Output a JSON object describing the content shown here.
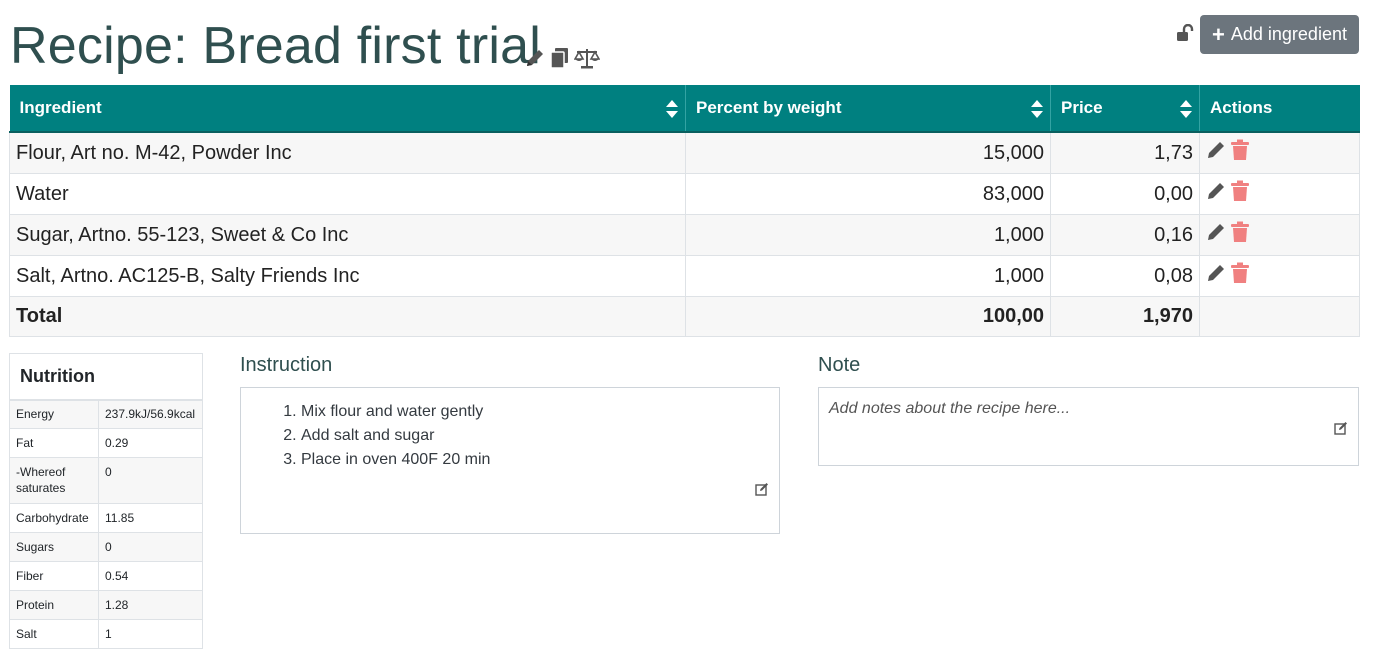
{
  "header": {
    "title": "Recipe: Bread first trial",
    "add_button_label": "Add ingredient"
  },
  "ingredients_table": {
    "columns": [
      "Ingredient",
      "Percent by weight",
      "Price",
      "Actions"
    ],
    "rows": [
      {
        "ingredient": "Flour, Art no. M-42, Powder Inc",
        "percent": "15,000",
        "price": "1,73"
      },
      {
        "ingredient": "Water",
        "percent": "83,000",
        "price": "0,00"
      },
      {
        "ingredient": "Sugar, Artno. 55-123, Sweet & Co Inc",
        "percent": "1,000",
        "price": "0,16"
      },
      {
        "ingredient": "Salt, Artno. AC125-B, Salty Friends Inc",
        "percent": "1,000",
        "price": "0,08"
      }
    ],
    "total": {
      "label": "Total",
      "percent": "100,00",
      "price": "1,970"
    }
  },
  "nutrition": {
    "title": "Nutrition",
    "rows": [
      {
        "label": "Energy",
        "value": "237.9kJ/56.9kcal"
      },
      {
        "label": "Fat",
        "value": "0.29"
      },
      {
        "label": "-Whereof saturates",
        "value": "0"
      },
      {
        "label": "Carbohydrate",
        "value": "11.85"
      },
      {
        "label": "Sugars",
        "value": "0"
      },
      {
        "label": "Fiber",
        "value": "0.54"
      },
      {
        "label": "Protein",
        "value": "1.28"
      },
      {
        "label": "Salt",
        "value": "1"
      }
    ]
  },
  "instruction": {
    "title": "Instruction",
    "steps": [
      "Mix flour and water gently",
      "Add salt and sugar",
      "Place in oven 400F 20 min"
    ]
  },
  "note": {
    "title": "Note",
    "placeholder": "Add notes about the recipe here..."
  },
  "colors": {
    "header_teal": "#008080",
    "title_color": "#2f4f4f",
    "delete_red": "#f08080",
    "button_gray": "#6c757d"
  },
  "icons": {
    "title": [
      "pencil-icon",
      "copy-icon",
      "scale-icon"
    ],
    "row_actions": [
      "pencil-icon",
      "trash-icon"
    ],
    "lock": "unlock-icon",
    "sort": "sort-icon",
    "edit": "edit-square-icon"
  }
}
